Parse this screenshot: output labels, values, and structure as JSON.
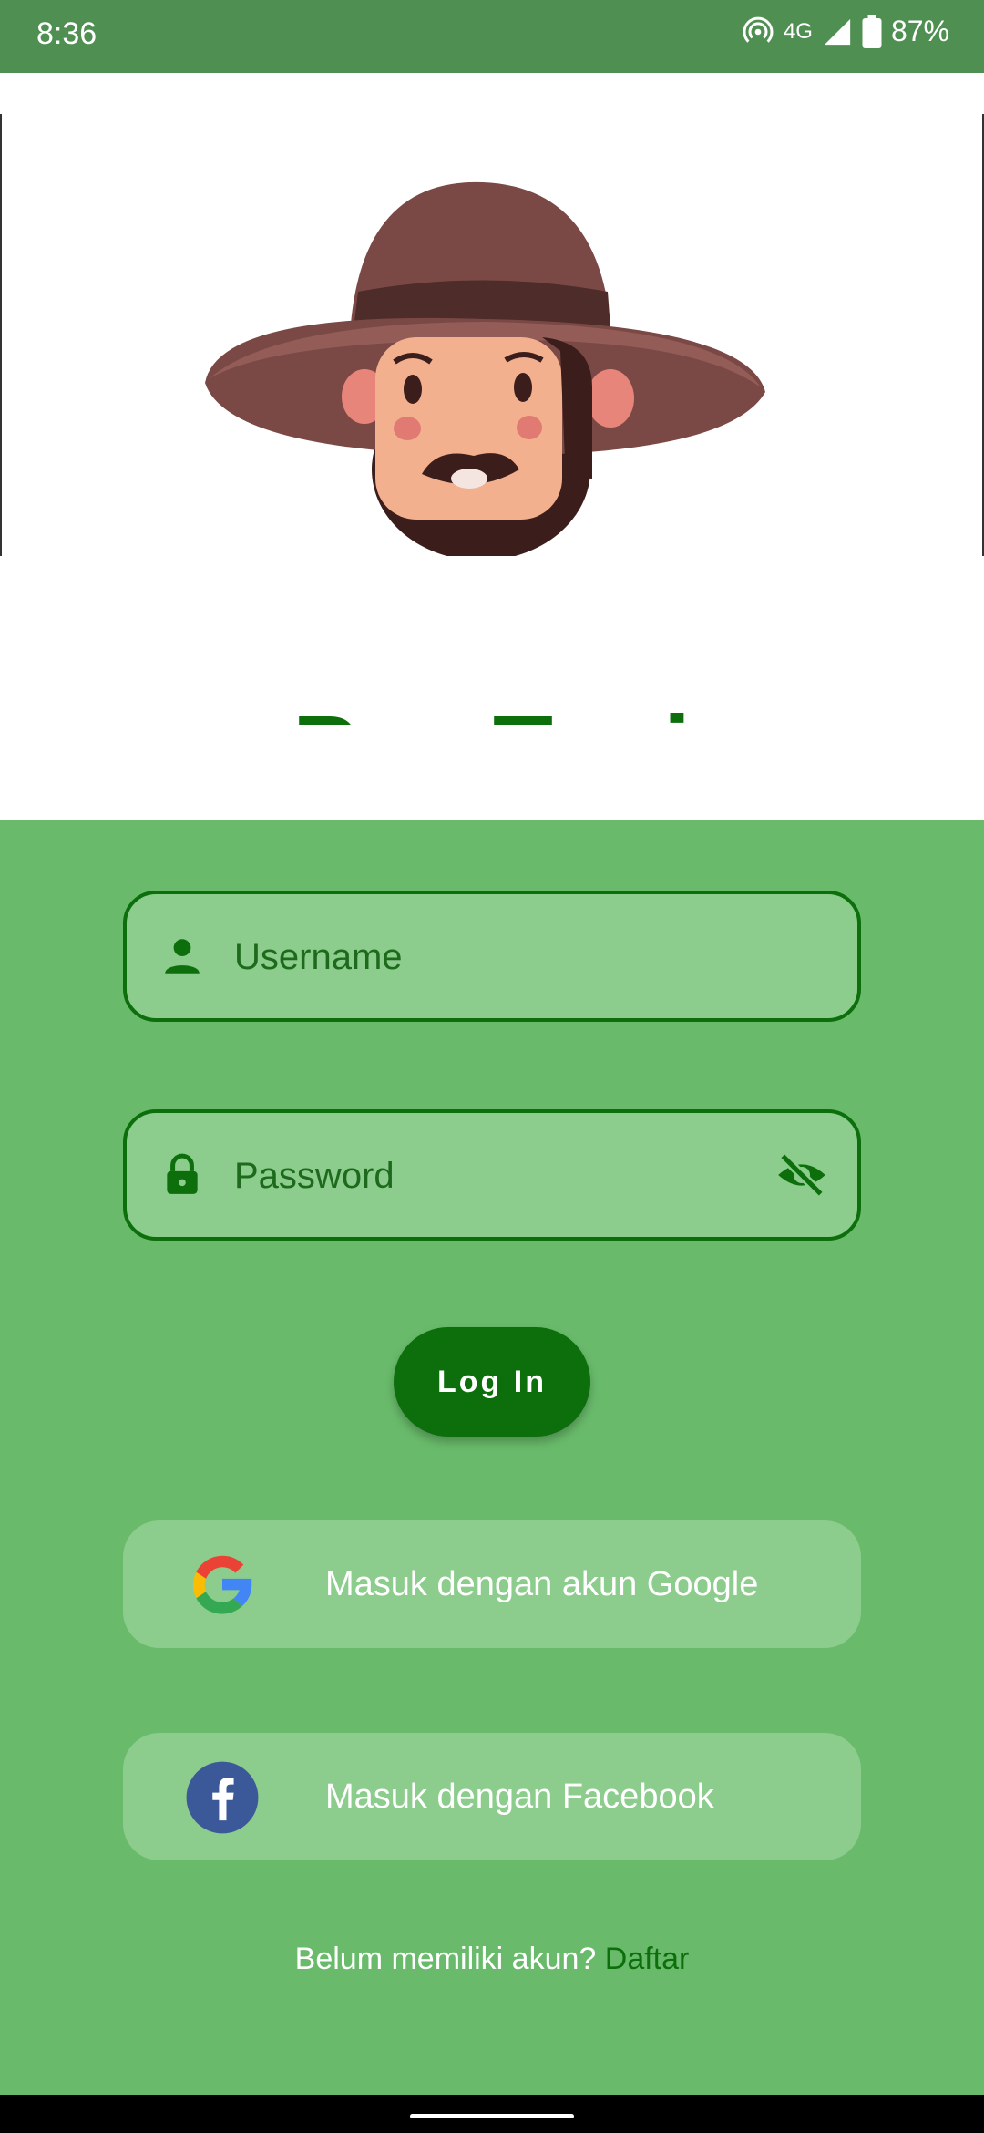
{
  "status_bar": {
    "time": "8:36",
    "network": "4G",
    "battery": "87%",
    "icons": [
      "hotspot-icon",
      "signal-icon",
      "battery-icon"
    ]
  },
  "app": {
    "title": "Pro-Tani",
    "illustration": "farmer-avatar-illustration"
  },
  "form": {
    "username": {
      "placeholder": "Username",
      "value": "",
      "icon": "person-icon"
    },
    "password": {
      "placeholder": "Password",
      "value": "",
      "icon": "lock-icon",
      "toggle_icon": "visibility-off-icon"
    },
    "login_label": "Log In"
  },
  "social": {
    "google_label": "Masuk dengan akun Google",
    "facebook_label": "Masuk dengan Facebook"
  },
  "signup": {
    "prompt": "Belum memiliki akun?",
    "link": "Daftar"
  },
  "colors": {
    "primary": "#0c6f0c",
    "background": "#69bb6b",
    "field_fill": "#8ccc8c",
    "status_bar": "#4f8f52"
  }
}
